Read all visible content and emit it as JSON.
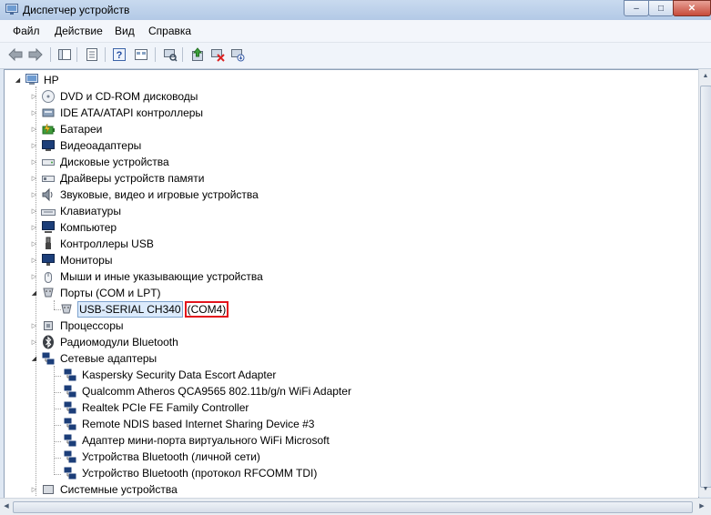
{
  "window": {
    "title": "Диспетчер устройств",
    "buttons": {
      "minimize": "–",
      "maximize": "□",
      "close": "✕"
    }
  },
  "menu": [
    "Файл",
    "Действие",
    "Вид",
    "Справка"
  ],
  "toolbar": [
    "back-icon",
    "forward-icon",
    "console-tree-icon",
    "properties-icon",
    "help-icon",
    "view-icon",
    "scan-hardware-icon",
    "update-driver-icon",
    "uninstall-icon",
    "disable-icon"
  ],
  "tree": {
    "root": "HP",
    "categories": [
      {
        "label": "DVD и CD-ROM дисководы",
        "icon": "dvd-icon"
      },
      {
        "label": "IDE ATA/ATAPI контроллеры",
        "icon": "ide-icon"
      },
      {
        "label": "Батареи",
        "icon": "battery-icon"
      },
      {
        "label": "Видеоадаптеры",
        "icon": "display-adapter-icon"
      },
      {
        "label": "Дисковые устройства",
        "icon": "disk-icon"
      },
      {
        "label": "Драйверы устройств памяти",
        "icon": "memory-icon"
      },
      {
        "label": "Звуковые, видео и игровые устройства",
        "icon": "sound-icon"
      },
      {
        "label": "Клавиатуры",
        "icon": "keyboard-icon"
      },
      {
        "label": "Компьютер",
        "icon": "computer-icon"
      },
      {
        "label": "Контроллеры USB",
        "icon": "usb-icon"
      },
      {
        "label": "Мониторы",
        "icon": "monitor-icon"
      },
      {
        "label": "Мыши и иные указывающие устройства",
        "icon": "mouse-icon"
      }
    ],
    "ports": {
      "label": "Порты (COM и LPT)",
      "child_name": "USB-SERIAL CH340",
      "child_port": "(COM4)"
    },
    "after_ports": [
      {
        "label": "Процессоры",
        "icon": "cpu-icon"
      },
      {
        "label": "Радиомодули Bluetooth",
        "icon": "bluetooth-icon"
      }
    ],
    "network": {
      "label": "Сетевые адаптеры",
      "children": [
        "Kaspersky Security Data Escort Adapter",
        "Qualcomm Atheros QCA9565 802.11b/g/n WiFi Adapter",
        "Realtek PCIe FE Family Controller",
        "Remote NDIS based Internet Sharing Device #3",
        "Адаптер мини-порта виртуального WiFi Microsoft",
        "Устройства Bluetooth (личной сети)",
        "Устройство Bluetooth (протокол RFCOMM TDI)"
      ]
    },
    "last": "Системные устройства"
  }
}
